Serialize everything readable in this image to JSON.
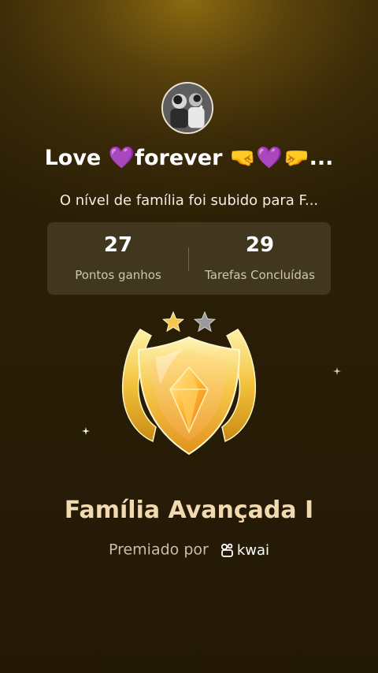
{
  "user": {
    "display_name": "Love 💜forever 🤜💜🤛...",
    "avatar_icon": "profile-photo-avatar"
  },
  "message": "O nível de família foi subido para F...",
  "stats": {
    "points_value": "27",
    "points_label": "Pontos ganhos",
    "tasks_value": "29",
    "tasks_label": "Tarefas Concluídas"
  },
  "rating": {
    "stars_earned": 1,
    "stars_total": 2,
    "earned_color": "#f2c94c",
    "empty_color": "#9a9a9a"
  },
  "level": {
    "title": "Família Avançada I",
    "emblem_icon": "gold-shield-gem-icon"
  },
  "awarded": {
    "prefix": "Premiado por",
    "brand": "kwai",
    "brand_icon": "kwai-logo-icon"
  },
  "colors": {
    "background_top": "#8a6a10",
    "background_bottom": "#2a1e06",
    "title_color": "#f3d9b0",
    "stats_panel": "rgba(150,140,120,0.22)"
  }
}
